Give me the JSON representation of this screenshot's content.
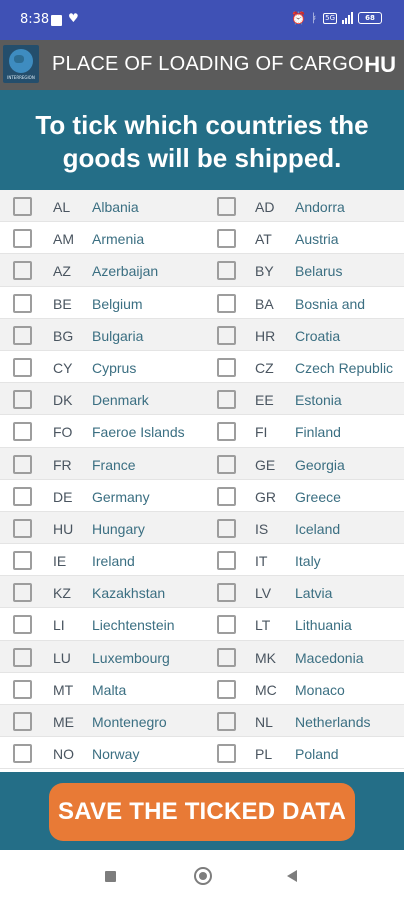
{
  "status_bar": {
    "time": "8:38",
    "heart": "♥",
    "battery": "68"
  },
  "app_bar": {
    "logo_text": "INTERREGION",
    "title": "PLACE OF LOADING OF CARGO",
    "language": "HU"
  },
  "banner": {
    "text": "To tick which countries the goods will be shipped."
  },
  "countries": [
    {
      "left": {
        "code": "AL",
        "name": "Albania",
        "checked": false
      },
      "right": {
        "code": "AD",
        "name": "Andorra",
        "checked": false
      }
    },
    {
      "left": {
        "code": "AM",
        "name": "Armenia",
        "checked": false
      },
      "right": {
        "code": "AT",
        "name": "Austria",
        "checked": false
      }
    },
    {
      "left": {
        "code": "AZ",
        "name": "Azerbaijan",
        "checked": false
      },
      "right": {
        "code": "BY",
        "name": "Belarus",
        "checked": false
      }
    },
    {
      "left": {
        "code": "BE",
        "name": "Belgium",
        "checked": false
      },
      "right": {
        "code": "BA",
        "name": "Bosnia and",
        "checked": false
      }
    },
    {
      "left": {
        "code": "BG",
        "name": "Bulgaria",
        "checked": false
      },
      "right": {
        "code": "HR",
        "name": "Croatia",
        "checked": false
      }
    },
    {
      "left": {
        "code": "CY",
        "name": "Cyprus",
        "checked": false
      },
      "right": {
        "code": "CZ",
        "name": "Czech Republic",
        "checked": false
      }
    },
    {
      "left": {
        "code": "DK",
        "name": "Denmark",
        "checked": false
      },
      "right": {
        "code": "EE",
        "name": "Estonia",
        "checked": false
      }
    },
    {
      "left": {
        "code": "FO",
        "name": "Faeroe Islands",
        "checked": false
      },
      "right": {
        "code": "FI",
        "name": "Finland",
        "checked": false
      }
    },
    {
      "left": {
        "code": "FR",
        "name": "France",
        "checked": false
      },
      "right": {
        "code": "GE",
        "name": "Georgia",
        "checked": false
      }
    },
    {
      "left": {
        "code": "DE",
        "name": "Germany",
        "checked": false
      },
      "right": {
        "code": "GR",
        "name": "Greece",
        "checked": false
      }
    },
    {
      "left": {
        "code": "HU",
        "name": "Hungary",
        "checked": false
      },
      "right": {
        "code": "IS",
        "name": "Iceland",
        "checked": false
      }
    },
    {
      "left": {
        "code": "IE",
        "name": "Ireland",
        "checked": false
      },
      "right": {
        "code": "IT",
        "name": "Italy",
        "checked": false
      }
    },
    {
      "left": {
        "code": "KZ",
        "name": "Kazakhstan",
        "checked": false
      },
      "right": {
        "code": "LV",
        "name": "Latvia",
        "checked": false
      }
    },
    {
      "left": {
        "code": "LI",
        "name": "Liechtenstein",
        "checked": false
      },
      "right": {
        "code": "LT",
        "name": "Lithuania",
        "checked": false
      }
    },
    {
      "left": {
        "code": "LU",
        "name": "Luxembourg",
        "checked": false
      },
      "right": {
        "code": "MK",
        "name": "Macedonia",
        "checked": false
      }
    },
    {
      "left": {
        "code": "MT",
        "name": "Malta",
        "checked": false
      },
      "right": {
        "code": "MC",
        "name": "Monaco",
        "checked": false
      }
    },
    {
      "left": {
        "code": "ME",
        "name": "Montenegro",
        "checked": false
      },
      "right": {
        "code": "NL",
        "name": "Netherlands",
        "checked": false
      }
    },
    {
      "left": {
        "code": "NO",
        "name": "Norway",
        "checked": false
      },
      "right": {
        "code": "PL",
        "name": "Poland",
        "checked": false
      }
    }
  ],
  "footer": {
    "save_label": "SAVE THE TICKED DATA"
  },
  "colors": {
    "status_bar": "#3f51b5",
    "app_bar": "#5b5b5b",
    "banner": "#246e87",
    "button": "#e87a36",
    "country_name": "#3b6f82"
  },
  "icons": {
    "nav_recents": "square-icon",
    "nav_home": "circle-icon",
    "nav_back": "triangle-back-icon"
  }
}
